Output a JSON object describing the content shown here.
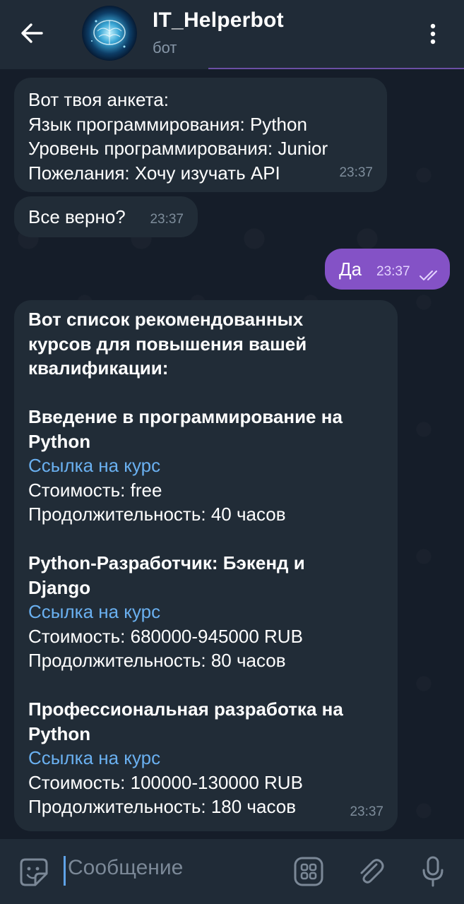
{
  "header": {
    "title": "IT_Helperbot",
    "subtitle": "бот"
  },
  "messages": [
    {
      "lines": [
        "Вот твоя анкета:",
        "Язык программирования: Python",
        "Уровень программирования: Junior",
        "Пожелания: Хочу изучать API"
      ],
      "time": "23:37"
    },
    {
      "text": "Все верно?",
      "time": "23:37"
    },
    {
      "text": "Да",
      "time": "23:37",
      "outgoing": true
    },
    {
      "intro": [
        "Вот список рекомендованных",
        "курсов для повышения вашей",
        "квалификации:"
      ],
      "courses": [
        {
          "title_lines": [
            "Введение в программирование на",
            "Python"
          ],
          "link": "Ссылка на курс",
          "price": "Стоимость: free",
          "duration": "Продолжительность: 40 часов"
        },
        {
          "title_lines": [
            "Python-Разработчик: Бэкенд и",
            "Django"
          ],
          "link": "Ссылка на курс",
          "price": "Стоимость: 680000-945000 RUB",
          "duration": "Продолжительность: 80 часов"
        },
        {
          "title_lines": [
            "Профессиональная разработка на",
            "Python"
          ],
          "link": "Ссылка на курс",
          "price": "Стоимость: 100000-130000 RUB",
          "duration": "Продолжительность: 180 часов"
        }
      ],
      "time": "23:37"
    }
  ],
  "input": {
    "placeholder": "Сообщение"
  },
  "colors": {
    "header_bg": "#202b37",
    "chat_bg": "#151d29",
    "incoming_bubble": "#212c37",
    "outgoing_bubble": "#8452c6",
    "link": "#6ab0f0"
  },
  "icons": [
    "back-arrow-icon",
    "bot-avatar",
    "more-vertical-icon",
    "double-check-icon",
    "sticker-icon",
    "bot-commands-icon",
    "paperclip-icon",
    "microphone-icon"
  ]
}
